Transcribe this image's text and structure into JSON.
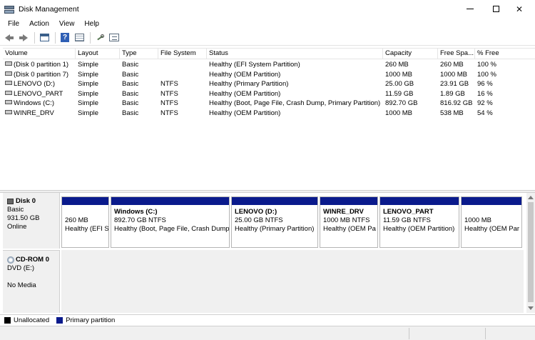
{
  "window": {
    "title": "Disk Management"
  },
  "menu": [
    "File",
    "Action",
    "View",
    "Help"
  ],
  "toolbar": {
    "icons": [
      "back-icon",
      "forward-icon",
      "console-tree-icon",
      "help-icon",
      "properties-icon",
      "connect-icon",
      "list-view-icon"
    ]
  },
  "volume_list": {
    "columns": [
      "Volume",
      "Layout",
      "Type",
      "File System",
      "Status",
      "Capacity",
      "Free Spa...",
      "% Free"
    ],
    "rows": [
      [
        "(Disk 0 partition 1)",
        "Simple",
        "Basic",
        "",
        "Healthy (EFI System Partition)",
        "260 MB",
        "260 MB",
        "100 %"
      ],
      [
        "(Disk 0 partition 7)",
        "Simple",
        "Basic",
        "",
        "Healthy (OEM Partition)",
        "1000 MB",
        "1000 MB",
        "100 %"
      ],
      [
        "LENOVO (D:)",
        "Simple",
        "Basic",
        "NTFS",
        "Healthy (Primary Partition)",
        "25.00 GB",
        "23.91 GB",
        "96 %"
      ],
      [
        "LENOVO_PART",
        "Simple",
        "Basic",
        "NTFS",
        "Healthy (OEM Partition)",
        "11.59 GB",
        "1.89 GB",
        "16 %"
      ],
      [
        "Windows (C:)",
        "Simple",
        "Basic",
        "NTFS",
        "Healthy (Boot, Page File, Crash Dump, Primary Partition)",
        "892.70 GB",
        "816.92 GB",
        "92 %"
      ],
      [
        "WINRE_DRV",
        "Simple",
        "Basic",
        "NTFS",
        "Healthy (OEM Partition)",
        "1000 MB",
        "538 MB",
        "54 %"
      ]
    ]
  },
  "disk0": {
    "name": "Disk 0",
    "type": "Basic",
    "size": "931.50 GB",
    "status": "Online",
    "partitions": [
      {
        "name": "",
        "size": "260 MB",
        "status": "Healthy (EFI S"
      },
      {
        "name": "Windows  (C:)",
        "size": "892.70 GB NTFS",
        "status": "Healthy (Boot, Page File, Crash Dump"
      },
      {
        "name": "LENOVO  (D:)",
        "size": "25.00 GB NTFS",
        "status": "Healthy (Primary Partition)"
      },
      {
        "name": "WINRE_DRV",
        "size": "1000 MB NTFS",
        "status": "Healthy (OEM Pa"
      },
      {
        "name": "LENOVO_PART",
        "size": "11.59 GB NTFS",
        "status": "Healthy (OEM Partition)"
      },
      {
        "name": "",
        "size": "1000 MB",
        "status": "Healthy (OEM Par"
      }
    ]
  },
  "cdrom0": {
    "name": "CD-ROM 0",
    "drive": "DVD (E:)",
    "media": "No Media"
  },
  "legend": [
    {
      "label": "Unallocated",
      "color": "#000000"
    },
    {
      "label": "Primary partition",
      "color": "#0a1a8c"
    }
  ]
}
